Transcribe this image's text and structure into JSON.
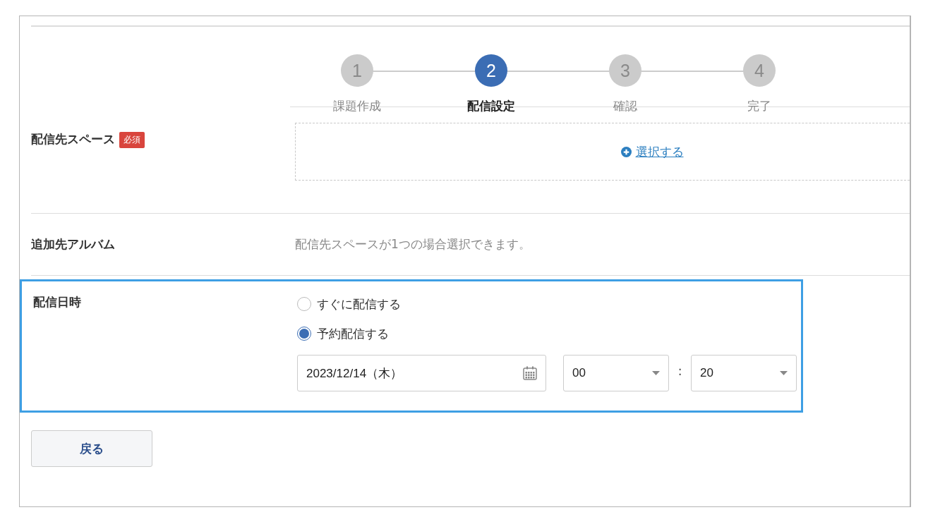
{
  "steps": [
    {
      "number": "1",
      "label": "課題作成",
      "selected": false
    },
    {
      "number": "2",
      "label": "配信設定",
      "selected": true
    },
    {
      "number": "3",
      "label": "確認",
      "selected": false
    },
    {
      "number": "4",
      "label": "完了",
      "selected": false
    }
  ],
  "destination": {
    "label": "配信先スペース",
    "required_badge": "必須",
    "select_link": "選択する"
  },
  "album": {
    "label": "追加先アルバム",
    "hint": "配信先スペースが1つの場合選択できます。"
  },
  "schedule": {
    "label": "配信日時",
    "highlighted": true,
    "options": [
      {
        "label": "すぐに配信する",
        "selected": false
      },
      {
        "label": "予約配信する",
        "selected": true
      }
    ],
    "date": "2023/12/14（木）",
    "hour": "00",
    "separator": ":",
    "minute": "20"
  },
  "back_button": "戻る"
}
